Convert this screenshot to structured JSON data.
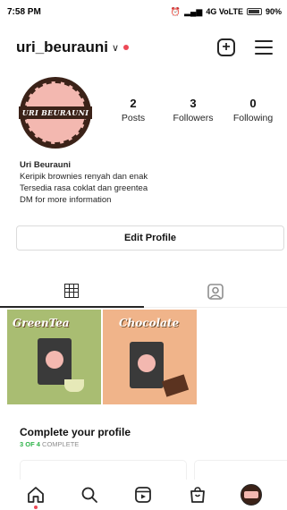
{
  "status_bar": {
    "time": "7:58 PM",
    "network": "4G VoLTE",
    "battery": "90%"
  },
  "header": {
    "username": "uri_beurauni",
    "notification_color": "#ed4956"
  },
  "profile": {
    "avatar_text": "URI BEURAUNI",
    "stats": [
      {
        "value": "2",
        "label": "Posts"
      },
      {
        "value": "3",
        "label": "Followers"
      },
      {
        "value": "0",
        "label": "Following"
      }
    ],
    "bio": {
      "name": "Uri Beurauni",
      "lines": [
        "Keripik brownies renyah dan enak",
        "Tersedia rasa coklat dan greentea",
        "DM for more information"
      ]
    },
    "edit_button": "Edit Profile"
  },
  "tabs": [
    {
      "icon": "grid-icon",
      "active": true
    },
    {
      "icon": "tagged-icon",
      "active": false
    }
  ],
  "posts": [
    {
      "title": "GreenTea",
      "color": "#a9bd72"
    },
    {
      "title": "Chocolate",
      "color": "#f0b48a"
    }
  ],
  "complete_profile": {
    "title": "Complete your profile",
    "progress_count": "3 OF 4",
    "progress_word": "COMPLETE",
    "accent": "#2fb34a"
  },
  "bottom_nav": [
    {
      "icon": "home-icon"
    },
    {
      "icon": "search-icon"
    },
    {
      "icon": "reels-icon"
    },
    {
      "icon": "shop-icon"
    },
    {
      "icon": "profile-avatar-icon"
    }
  ]
}
